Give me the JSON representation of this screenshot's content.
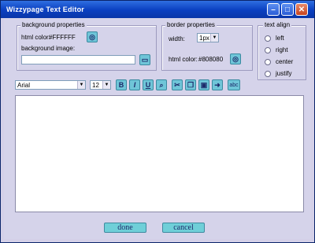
{
  "window": {
    "title": "Wizzypage Text  Editor",
    "min": "–",
    "max": "□",
    "close": "✕"
  },
  "background": {
    "legend": "background properties",
    "html_color_label": "html color:",
    "html_color_value": "#FFFFFF",
    "image_label": "background image:",
    "image_value": ""
  },
  "border": {
    "legend": "border properties",
    "width_label": "width:",
    "width_value": "1px",
    "html_color_label": "html color:",
    "html_color_value": "#808080"
  },
  "align": {
    "legend": "text align",
    "options": [
      "left",
      "right",
      "center",
      "justify"
    ]
  },
  "toolbar": {
    "font": "Arial",
    "size": "12",
    "bold": "B",
    "italic": "I",
    "underline": "U",
    "spell": "abc"
  },
  "actions": {
    "done": "done",
    "cancel": "cancel"
  }
}
